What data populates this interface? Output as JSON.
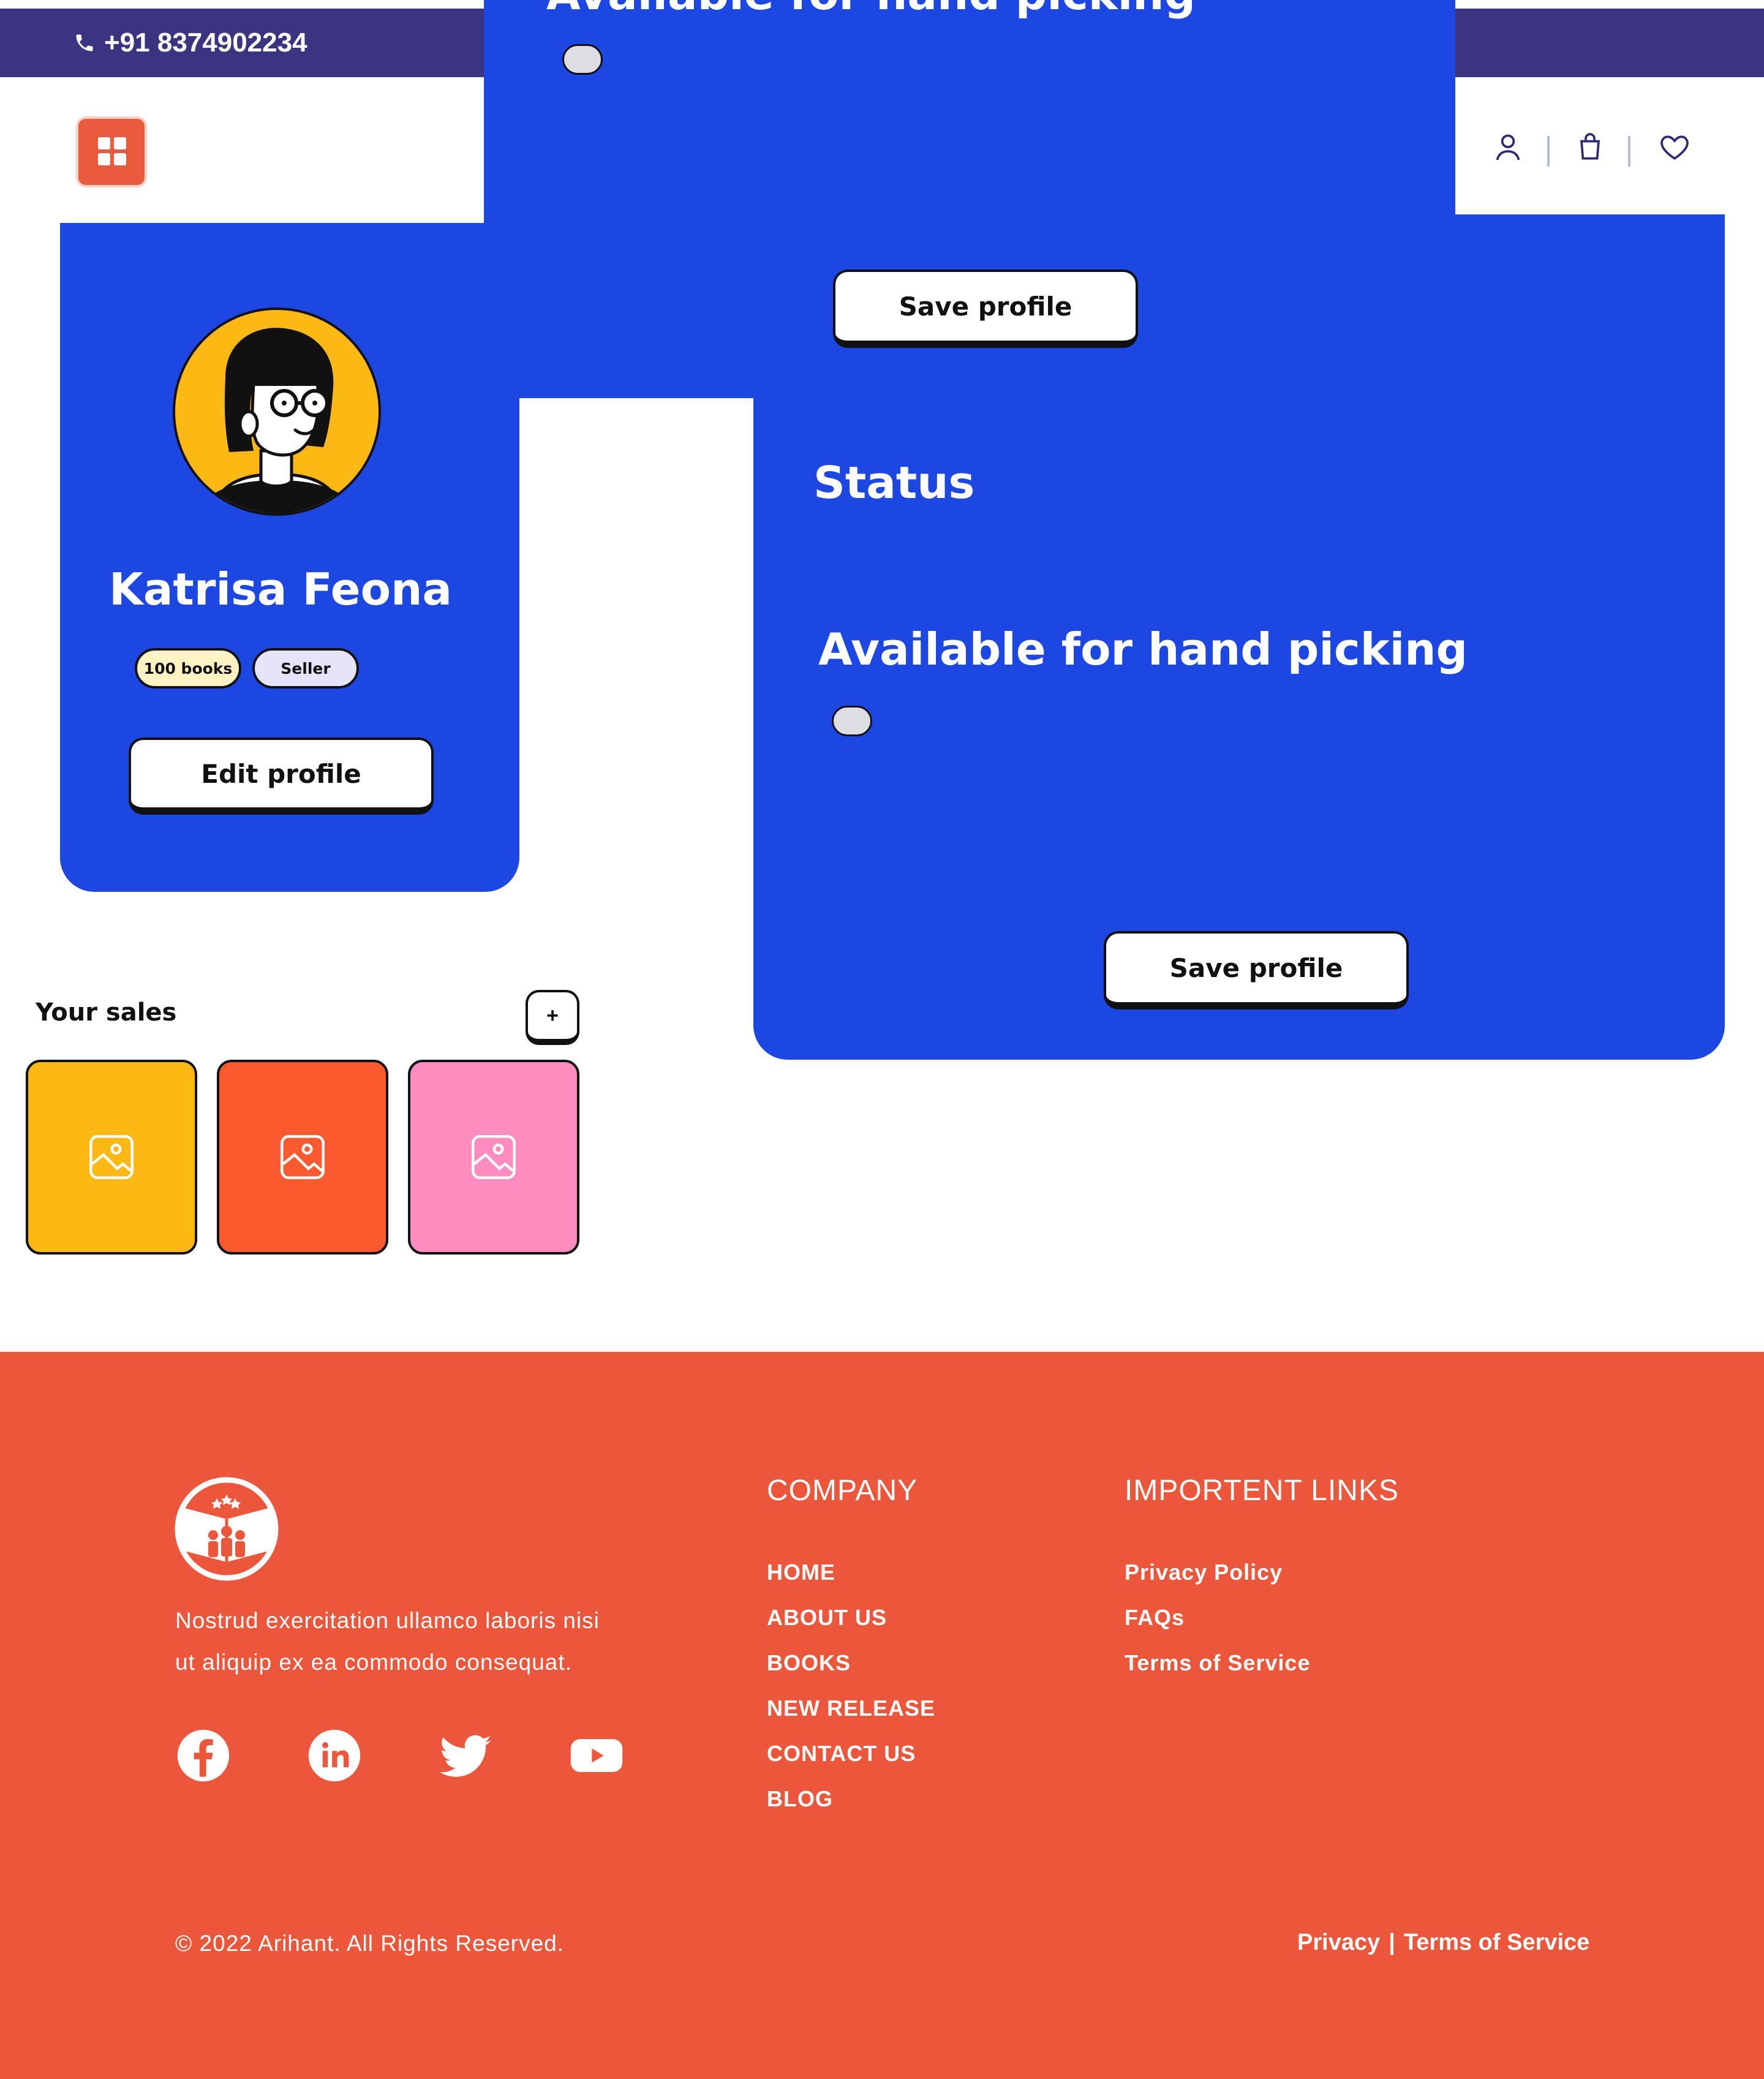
{
  "topbar": {
    "phone": "+91 8374902234",
    "phone_icon": "phone-icon"
  },
  "header": {
    "logo_icon": "grid-app-icon",
    "icons": [
      "user-icon",
      "shopping-bag-icon",
      "heart-icon"
    ]
  },
  "profile": {
    "name": "Katrisa Feona",
    "books_badge": "100 books",
    "role_badge": "Seller",
    "edit_label": "Edit profile",
    "avatar_icon": "woman-avatar-illustration"
  },
  "status_overlap": {
    "available_label": "Available for hand picking",
    "save_label": "Save profile"
  },
  "status": {
    "title": "Status",
    "available_label": "Available for hand picking",
    "save_label": "Save profile"
  },
  "sales": {
    "title": "Your sales",
    "add_label": "+",
    "tiles": [
      {
        "color": "#fdb913",
        "icon": "image-placeholder-icon"
      },
      {
        "color": "#fb5a2e",
        "icon": "image-placeholder-icon"
      },
      {
        "color": "#ff8cbe",
        "icon": "image-placeholder-icon"
      }
    ]
  },
  "footer": {
    "tagline_line1": "Nostrud exercitation ullamco laboris nisi",
    "tagline_line2": "ut aliquip ex ea commodo consequat.",
    "company_heading": "COMPANY",
    "company_links": [
      "HOME",
      "ABOUT US",
      "BOOKS",
      "NEW RELEASE",
      "CONTACT US",
      "BLOG"
    ],
    "links_heading": "IMPORTENT LINKS",
    "important_links": [
      "Privacy Policy",
      "FAQs",
      "Terms of Service"
    ],
    "social": [
      "facebook-icon",
      "linkedin-icon",
      "twitter-icon",
      "youtube-icon"
    ],
    "copyright": "© 2022 Arihant. All Rights Reserved.",
    "bottom_privacy": "Privacy",
    "bottom_separator": "|",
    "bottom_terms": "Terms of Service"
  },
  "colors": {
    "topbar": "#3b3480",
    "panel_blue": "#1c47e3",
    "footer": "#ec573c",
    "accent_red": "#ea5a3d",
    "badge_yellow": "#fff3c4",
    "badge_lavender": "#e5e4fb"
  }
}
